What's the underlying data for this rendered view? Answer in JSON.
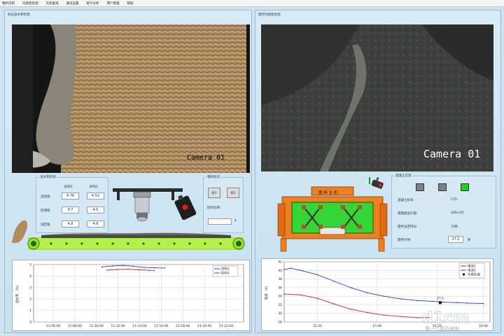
{
  "menu": [
    "物料识别",
    "均质性检测",
    "历史查询",
    "通讯设置",
    "统计分析",
    "用户管理",
    "帮助"
  ],
  "left_panel": {
    "title": "砂石含水率检测",
    "camera_label": "Camera 01",
    "moisture_group": {
      "title": "含水率检测",
      "col_headers": [
        "砂料1",
        "砂料2"
      ],
      "rows": [
        {
          "label": "当前值",
          "v1": "4.76",
          "v2": "4.52"
        },
        {
          "label": "检测值",
          "v1": "4.7",
          "v2": "4.5"
        },
        {
          "label": "设定值",
          "v1": "4.8",
          "v2": "4.6"
        }
      ]
    },
    "material_group": {
      "title": "物料标识",
      "btn1": "砂1",
      "btn2": "砂2",
      "sand_rate_label": "砂料比率:",
      "sand_rate_value": "",
      "sand_rate_unit": "$"
    }
  },
  "right_panel": {
    "title": "搅拌均质性检测",
    "camera_label": "Camera 01",
    "mixer_label": "搅 拌 主 机",
    "concrete_group": {
      "title": "混凝土信息",
      "rows": [
        {
          "label": "混凝土标号:",
          "value": "C25"
        },
        {
          "label": "塌落度设计值:",
          "value": "180±20"
        },
        {
          "label": "搅拌设定时长:",
          "value": "25秒"
        }
      ],
      "timer_label": "搅拌计时:",
      "timer_value": "27.2",
      "timer_unit": "秒"
    },
    "status_colors": [
      "#7d8287",
      "#7d8287",
      "#19d419"
    ]
  },
  "chart_data": [
    {
      "type": "line",
      "ylabel": "含水率 （%）",
      "x_ticks": [
        "11:06:00",
        "11:08:00",
        "11:10:00",
        "11:12:00",
        "11:14:00",
        "11:16:00",
        "11:18:00",
        "11:20:00",
        "11:22:00"
      ],
      "y_ticks": [
        0,
        1,
        2,
        3,
        4,
        5
      ],
      "ylim": [
        0,
        5
      ],
      "series": [
        {
          "name": "砂料1",
          "color": "#1f3fd8",
          "x": [
            11.15,
            11.17,
            11.19,
            11.21,
            11.23,
            11.25,
            11.27
          ],
          "y": [
            4.8,
            4.88,
            4.92,
            4.86,
            4.75,
            4.72,
            4.7
          ]
        },
        {
          "name": "砂料2",
          "color": "#d21f1f",
          "x": [
            11.16,
            11.18,
            11.2,
            11.22,
            11.24,
            11.25
          ],
          "y": [
            4.52,
            4.58,
            4.6,
            4.55,
            4.5,
            4.48
          ]
        }
      ],
      "legend": "top-right"
    },
    {
      "type": "line",
      "ylabel": "电流 （A）",
      "x_ticks": [
        "15:30",
        "15:40",
        "15:50",
        "16:00"
      ],
      "y_ticks": [
        28,
        30,
        32,
        34,
        36,
        38,
        40,
        42
      ],
      "ylim": [
        28,
        42
      ],
      "series": [
        {
          "name": "电流1",
          "color": "#1f3fd8",
          "x": [
            0,
            2,
            5,
            10,
            15,
            20,
            25,
            30,
            35,
            40,
            45,
            48,
            52,
            55,
            60
          ],
          "y": [
            40.2,
            40.5,
            40,
            39,
            37.5,
            36,
            34.8,
            34,
            33.4,
            33,
            32.8,
            32.6,
            32.5,
            32.4,
            32.3
          ]
        },
        {
          "name": "电流2",
          "color": "#d21f1f",
          "x": [
            0,
            5,
            10,
            15,
            20,
            25,
            30,
            35,
            40,
            44
          ],
          "y": [
            34.5,
            34.3,
            33.5,
            32.2,
            31,
            30.2,
            29.6,
            29.3,
            29,
            29
          ]
        },
        {
          "name": "匀质标准",
          "color": "#111111",
          "x": [
            47
          ],
          "y": [
            32.5
          ]
        }
      ],
      "annotation": "27.5",
      "legend": "top-right"
    }
  ],
  "watermark": {
    "logo": "d1cm",
    "text": "第一工程机械网"
  }
}
